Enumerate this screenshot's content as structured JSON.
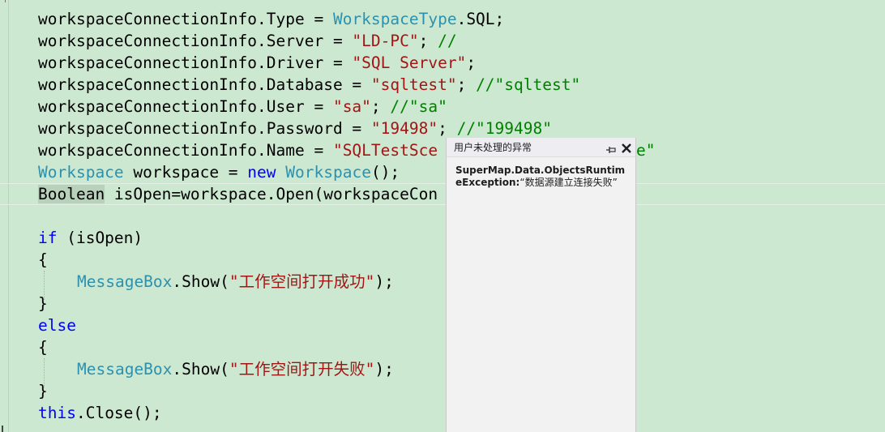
{
  "code": {
    "l1": {
      "a": "workspaceConnectionInfo.Type = ",
      "b": "WorkspaceType",
      "c": ".SQL;"
    },
    "l2": {
      "a": "workspaceConnectionInfo.Server = ",
      "b": "\"LD-PC\"",
      "c": "; ",
      "d": "//"
    },
    "l3": {
      "a": "workspaceConnectionInfo.Driver = ",
      "b": "\"SQL Server\"",
      "c": ";"
    },
    "l4": {
      "a": "workspaceConnectionInfo.Database = ",
      "b": "\"sqltest\"",
      "c": "; ",
      "d": "//\"sqltest\""
    },
    "l5": {
      "a": "workspaceConnectionInfo.User = ",
      "b": "\"sa\"",
      "c": "; ",
      "d": "//\"sa\""
    },
    "l6": {
      "a": "workspaceConnectionInfo.Password = ",
      "b": "\"19498\"",
      "c": "; ",
      "d": "//\"199498\""
    },
    "l7": {
      "a": "workspaceConnectionInfo.Name = ",
      "b": "\"SQLTestSce",
      "c": "",
      "d": "e\""
    },
    "l8": {
      "a": "Workspace",
      "b": " workspace = ",
      "c": "new",
      "d": " ",
      "e": "Workspace",
      "f": "();"
    },
    "l9": {
      "a": "Boolean",
      "b": " isOpen=workspace.Open(workspaceCon"
    },
    "l11": {
      "a": "if",
      "b": " (isOpen)"
    },
    "l12": {
      "a": "{"
    },
    "l13": {
      "a": "MessageBox",
      "b": ".Show(",
      "c": "\"工作空间打开成功\"",
      "d": ");"
    },
    "l14": {
      "a": "}"
    },
    "l15": {
      "a": "else"
    },
    "l16": {
      "a": "{"
    },
    "l17": {
      "a": "MessageBox",
      "b": ".Show(",
      "c": "\"工作空间打开失败\"",
      "d": ");"
    },
    "l18": {
      "a": "}"
    },
    "l19": {
      "a": "this",
      "b": ".Close();"
    }
  },
  "exception_popup": {
    "title": "用户未处理的异常",
    "pin_icon": "pin-icon",
    "close_icon": "close-icon",
    "exception_type": "SuperMap.Data.ObjectsRuntimeException:",
    "message": "“数据源建立连接失败”"
  },
  "colors": {
    "editor_background": "#cde8d0",
    "type": "#2b91af",
    "keyword": "#0000ff",
    "string": "#a31515",
    "comment": "#008000"
  }
}
